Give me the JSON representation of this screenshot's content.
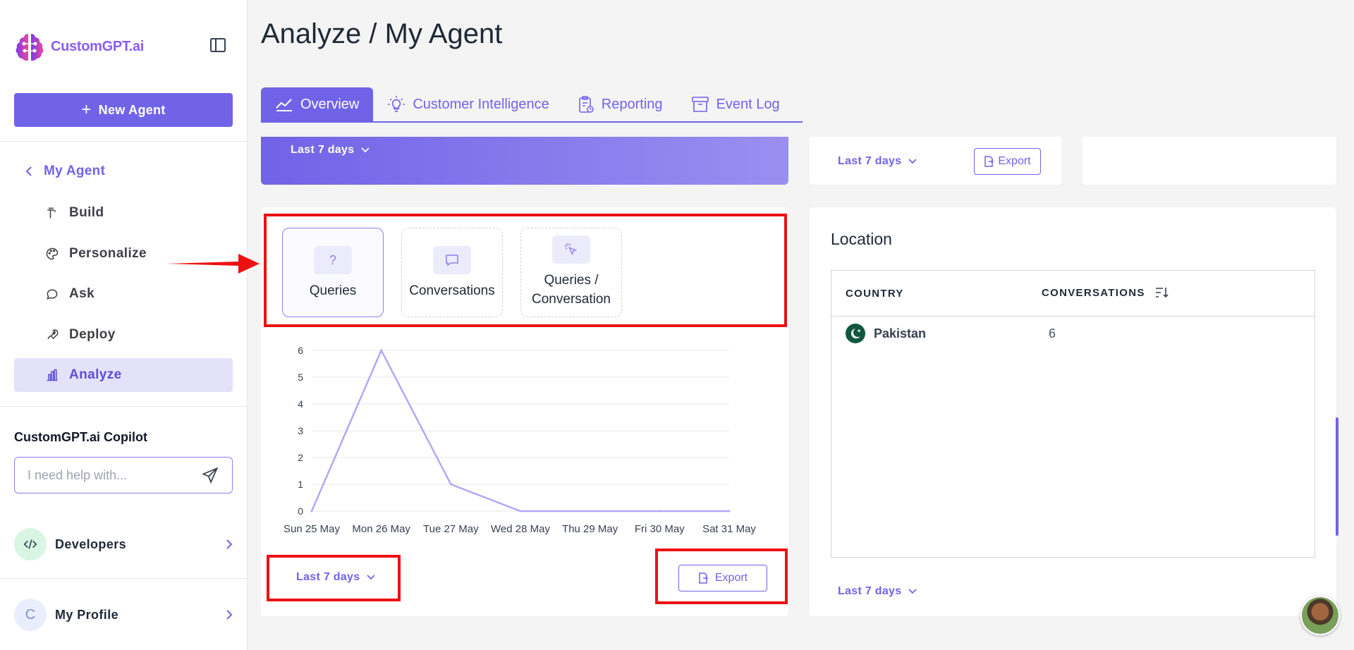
{
  "app": {
    "brand": "CustomGPT.ai",
    "page_title": "Analyze / My Agent"
  },
  "sidebar": {
    "new_agent": "New Agent",
    "back": "My Agent",
    "items": [
      {
        "label": "Build",
        "icon": "hammer-icon"
      },
      {
        "label": "Personalize",
        "icon": "palette-icon"
      },
      {
        "label": "Ask",
        "icon": "chat-bubble-icon"
      },
      {
        "label": "Deploy",
        "icon": "rocket-icon"
      },
      {
        "label": "Analyze",
        "icon": "bar-chart-icon",
        "active": true
      }
    ],
    "copilot_title": "CustomGPT.ai Copilot",
    "copilot_placeholder": "I need help with...",
    "developers": "Developers",
    "profile": "My Profile",
    "profile_initial": "C"
  },
  "tabs": [
    {
      "label": "Overview",
      "icon": "line-chart-icon",
      "active": true
    },
    {
      "label": "Customer Intelligence",
      "icon": "lightbulb-icon"
    },
    {
      "label": "Reporting",
      "icon": "clipboard-icon"
    },
    {
      "label": "Event Log",
      "icon": "archive-icon"
    }
  ],
  "top_cards": {
    "purple_range": "Last 7 days",
    "mid_range": "Last 7 days",
    "mid_export": "Export"
  },
  "metrics": [
    {
      "label": "Queries",
      "icon": "question-icon",
      "selected": true
    },
    {
      "label": "Conversations",
      "icon": "message-icon"
    },
    {
      "label": "Queries / Conversation",
      "icon": "cursor-click-icon"
    }
  ],
  "chart_data": {
    "type": "line",
    "categories": [
      "Sun 25 May",
      "Mon 26 May",
      "Tue 27 May",
      "Wed 28 May",
      "Thu 29 May",
      "Fri 30 May",
      "Sat 31 May"
    ],
    "values": [
      0,
      6,
      1,
      0,
      0,
      0,
      0
    ],
    "ylim": [
      0,
      6
    ],
    "yticks": [
      0,
      1,
      2,
      3,
      4,
      5,
      6
    ],
    "grid": true,
    "color": "#b1a8f5"
  },
  "chart_footer": {
    "range": "Last 7 days",
    "export": "Export"
  },
  "location": {
    "title": "Location",
    "col_country": "COUNTRY",
    "col_conversations": "CONVERSATIONS",
    "rows": [
      {
        "country": "Pakistan",
        "conversations": "6"
      }
    ],
    "range": "Last 7 days"
  },
  "colors": {
    "accent": "#7063e8",
    "highlight": "#ee1111"
  }
}
